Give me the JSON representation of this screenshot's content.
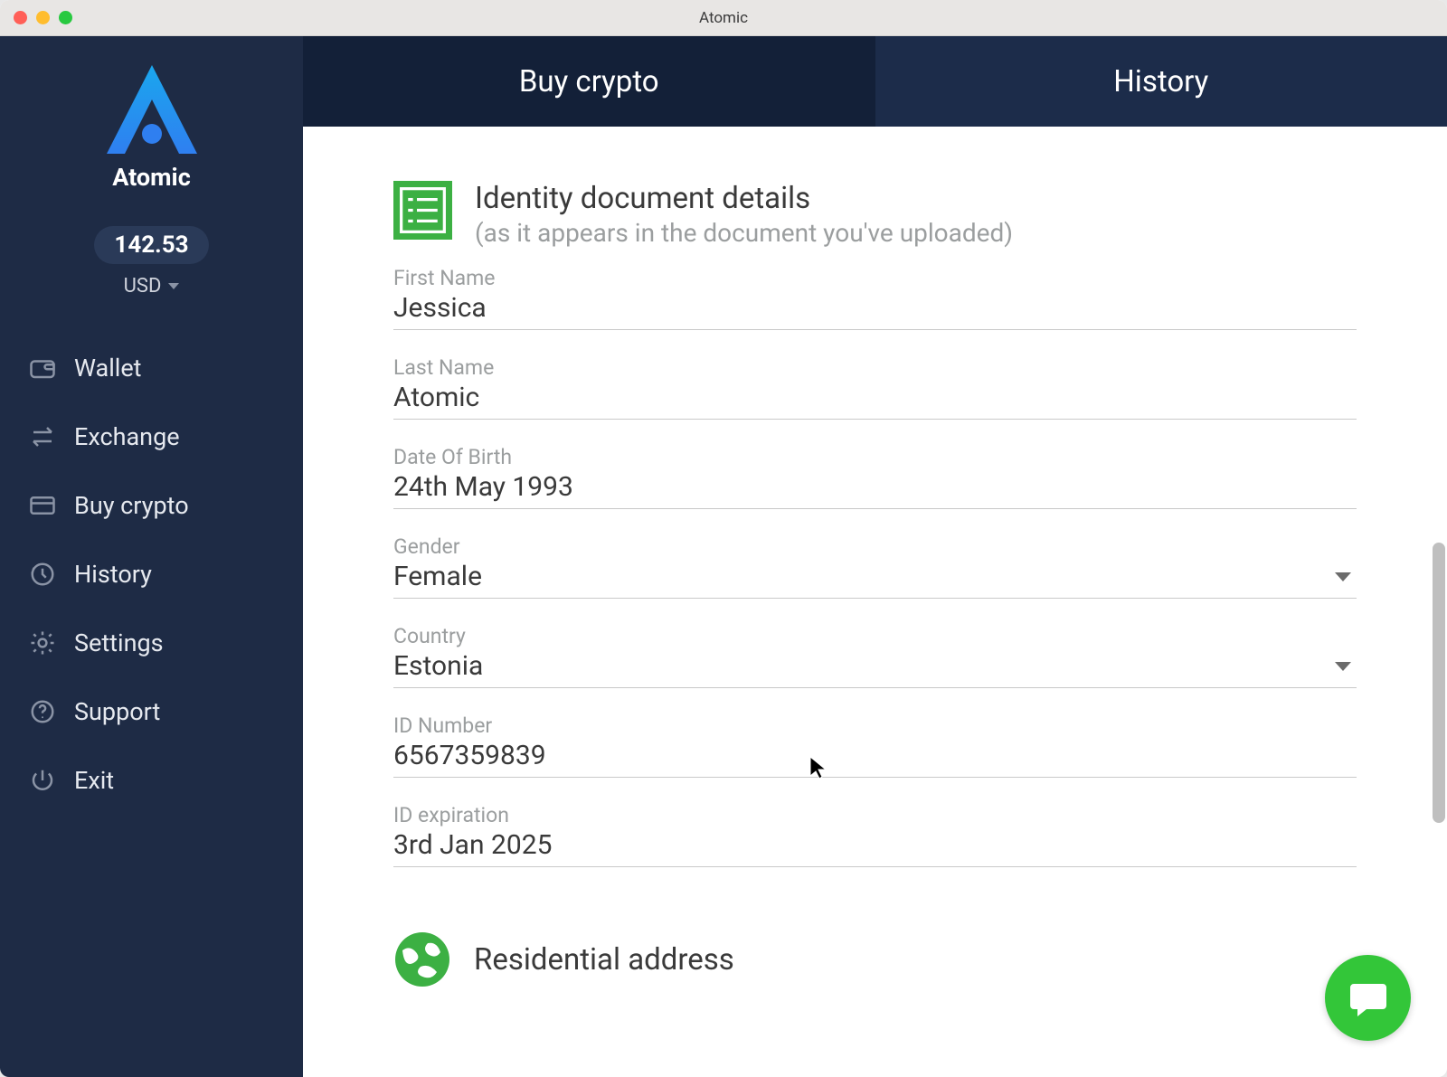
{
  "window_title": "Atomic",
  "brand": "Atomic",
  "balance": "142.53",
  "currency": "USD",
  "sidebar": {
    "items": [
      {
        "label": "Wallet"
      },
      {
        "label": "Exchange"
      },
      {
        "label": "Buy crypto"
      },
      {
        "label": "History"
      },
      {
        "label": "Settings"
      },
      {
        "label": "Support"
      },
      {
        "label": "Exit"
      }
    ]
  },
  "tabs": {
    "buy": "Buy crypto",
    "history": "History"
  },
  "identity": {
    "title": "Identity document details",
    "subtitle": "(as it appears in the document you've uploaded)",
    "fields": {
      "first_name_label": "First Name",
      "first_name": "Jessica",
      "last_name_label": "Last Name",
      "last_name": "Atomic",
      "dob_label": "Date Of Birth",
      "dob": "24th May 1993",
      "gender_label": "Gender",
      "gender": "Female",
      "country_label": "Country",
      "country": "Estonia",
      "id_number_label": "ID Number",
      "id_number": "6567359839",
      "id_expiration_label": "ID expiration",
      "id_expiration": "3rd Jan 2025"
    }
  },
  "residential": {
    "title": "Residential address"
  }
}
